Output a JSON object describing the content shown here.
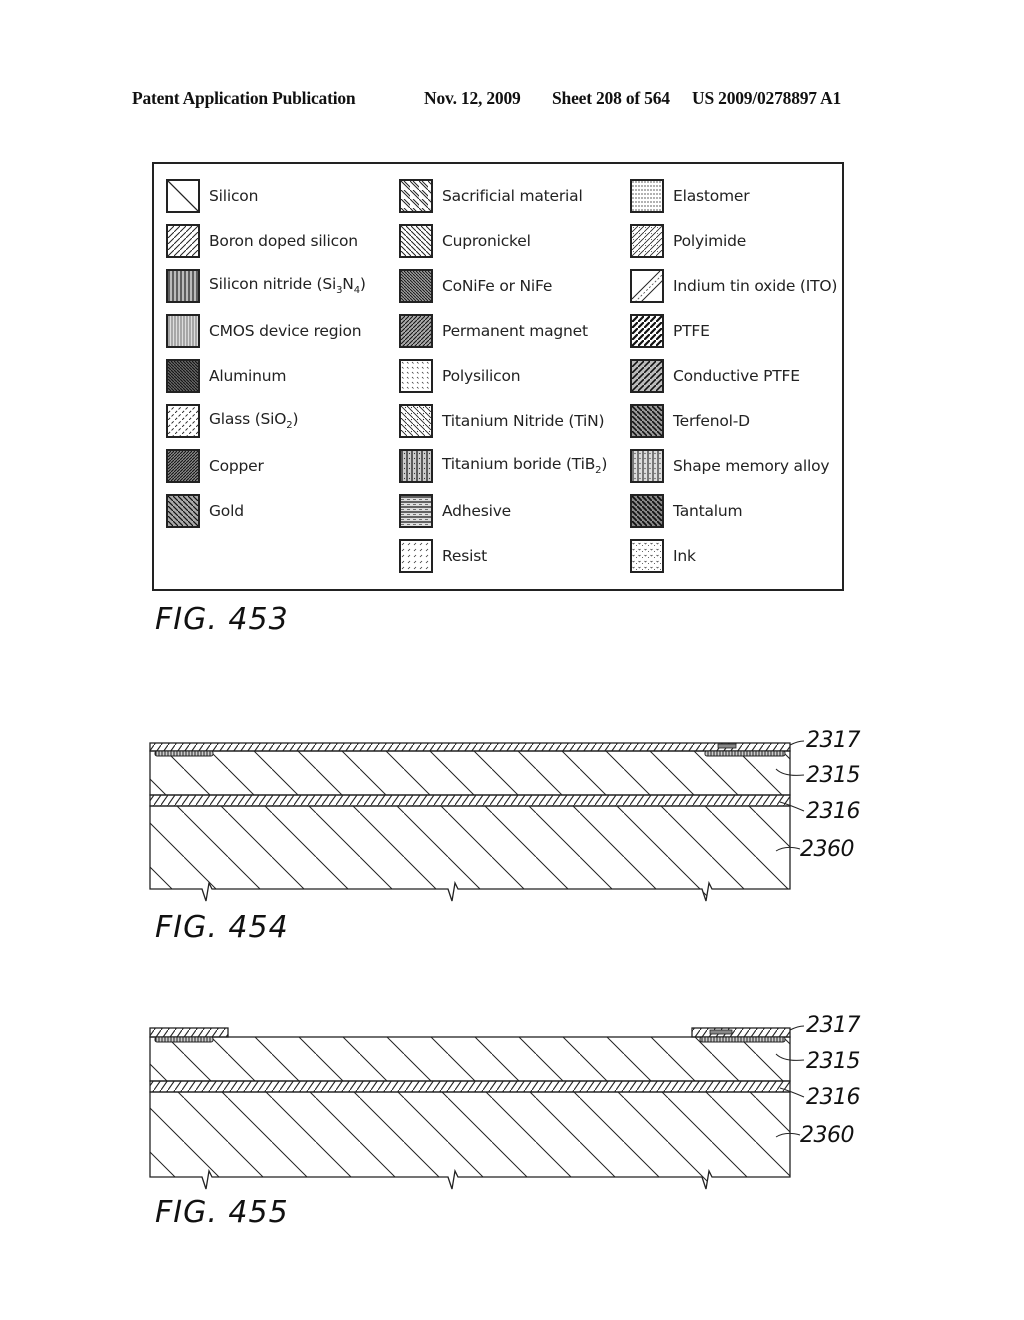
{
  "header": {
    "publication": "Patent Application Publication",
    "date": "Nov. 12, 2009",
    "sheet": "Sheet 208 of 564",
    "patent_number": "US 2009/0278897 A1"
  },
  "legend": {
    "figure": "FIG. 453",
    "columns": [
      [
        {
          "label": "Silicon",
          "pattern": "silicon"
        },
        {
          "label": "Boron doped silicon",
          "pattern": "boron"
        },
        {
          "label": "Silicon nitride (Si",
          "sub1": "3",
          "mid": "N",
          "sub2": "4",
          "end": ")",
          "pattern": "nitride"
        },
        {
          "label": "CMOS device region",
          "pattern": "cmos"
        },
        {
          "label": "Aluminum",
          "pattern": "aluminum"
        },
        {
          "label": "Glass (SiO",
          "sub1": "2",
          "end": ")",
          "pattern": "glass"
        },
        {
          "label": "Copper",
          "pattern": "copper"
        },
        {
          "label": "Gold",
          "pattern": "gold"
        }
      ],
      [
        {
          "label": "Sacrificial material",
          "pattern": "sacrificial"
        },
        {
          "label": "Cupronickel",
          "pattern": "cupronickel"
        },
        {
          "label": "CoNiFe or NiFe",
          "pattern": "conife"
        },
        {
          "label": "Permanent magnet",
          "pattern": "magnet"
        },
        {
          "label": "Polysilicon",
          "pattern": "polysilicon"
        },
        {
          "label": "Titanium Nitride (TiN)",
          "pattern": "tin"
        },
        {
          "label": "Titanium boride (TiB",
          "sub1": "2",
          "end": ")",
          "pattern": "tib2"
        },
        {
          "label": "Adhesive",
          "pattern": "adhesive"
        },
        {
          "label": "Resist",
          "pattern": "resist"
        }
      ],
      [
        {
          "label": "Elastomer",
          "pattern": "elastomer"
        },
        {
          "label": "Polyimide",
          "pattern": "polyimide"
        },
        {
          "label": "Indium tin oxide (ITO)",
          "pattern": "ito"
        },
        {
          "label": "PTFE",
          "pattern": "ptfe"
        },
        {
          "label": "Conductive PTFE",
          "pattern": "cptfe"
        },
        {
          "label": "Terfenol-D",
          "pattern": "terfenol"
        },
        {
          "label": "Shape memory alloy",
          "pattern": "sma"
        },
        {
          "label": "Tantalum",
          "pattern": "tantalum"
        },
        {
          "label": "Ink",
          "pattern": "ink"
        }
      ]
    ]
  },
  "figures": [
    {
      "caption": "FIG. 454",
      "refs": [
        "2317",
        "2315",
        "2316",
        "2360"
      ]
    },
    {
      "caption": "FIG. 455",
      "refs": [
        "2317",
        "2315",
        "2316",
        "2360"
      ]
    }
  ]
}
